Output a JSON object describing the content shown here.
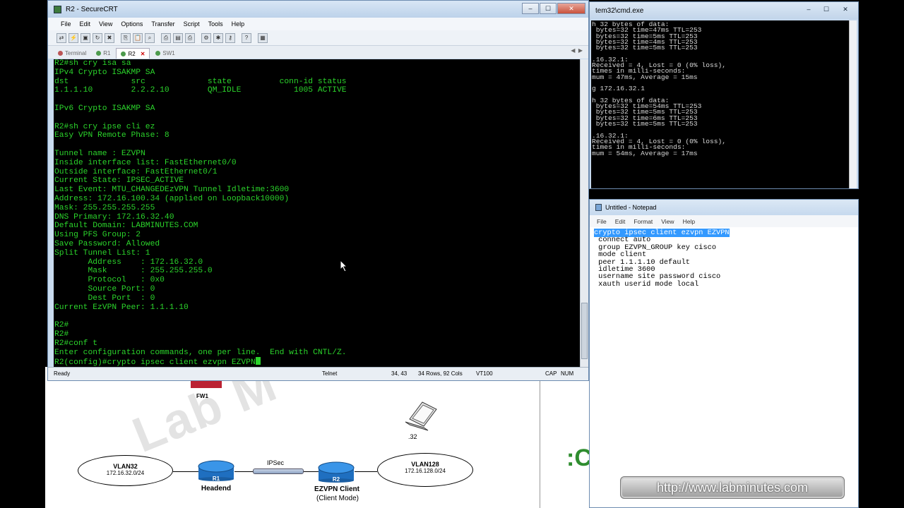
{
  "crt": {
    "title": "R2 - SecureCRT",
    "menu": [
      "File",
      "Edit",
      "View",
      "Options",
      "Transfer",
      "Script",
      "Tools",
      "Help"
    ],
    "tabs": [
      {
        "label": "Terminal",
        "active": false
      },
      {
        "label": "R1",
        "active": false
      },
      {
        "label": "R2",
        "active": true
      },
      {
        "label": "SW1",
        "active": false
      }
    ],
    "terminal_lines": [
      "R2#sh cry isa sa",
      "IPv4 Crypto ISAKMP SA",
      "dst             src             state          conn-id status",
      "1.1.1.10        2.2.2.10        QM_IDLE           1005 ACTIVE",
      "",
      "IPv6 Crypto ISAKMP SA",
      "",
      "R2#sh cry ipse cli ez",
      "Easy VPN Remote Phase: 8",
      "",
      "Tunnel name : EZVPN",
      "Inside interface list: FastEthernet0/0",
      "Outside interface: FastEthernet0/1",
      "Current State: IPSEC_ACTIVE",
      "Last Event: MTU_CHANGEDEzVPN Tunnel Idletime:3600",
      "Address: 172.16.100.34 (applied on Loopback10000)",
      "Mask: 255.255.255.255",
      "DNS Primary: 172.16.32.40",
      "Default Domain: LABMINUTES.COM",
      "Using PFS Group: 2",
      "Save Password: Allowed",
      "Split Tunnel List: 1",
      "       Address    : 172.16.32.0",
      "       Mask       : 255.255.255.0",
      "       Protocol   : 0x0",
      "       Source Port: 0",
      "       Dest Port  : 0",
      "Current EzVPN Peer: 1.1.1.10",
      "",
      "R2#",
      "R2#",
      "R2#conf t",
      "Enter configuration commands, one per line.  End with CNTL/Z.",
      "R2(config)#crypto ipsec client ezvpn EZVPN"
    ],
    "status": {
      "ready": "Ready",
      "protocol": "Telnet",
      "cursor_pos": "34, 43",
      "size": "34 Rows, 92 Cols",
      "emulation": "VT100",
      "caps": "CAP",
      "num": "NUM"
    }
  },
  "cmd": {
    "title": "tem32\\cmd.exe",
    "lines": [
      "h 32 bytes of data:",
      " bytes=32 time=47ms TTL=253",
      " bytes=32 time=5ms TTL=253",
      " bytes=32 time=4ms TTL=253",
      " bytes=32 time=5ms TTL=253",
      "",
      ".16.32.1:",
      "Received = 4, Lost = 0 (0% loss),",
      "times in milli-seconds:",
      "mum = 47ms, Average = 15ms",
      "",
      "g 172.16.32.1",
      "",
      "h 32 bytes of data:",
      " bytes=32 time=54ms TTL=253",
      " bytes=32 time=5ms TTL=253",
      " bytes=32 time=6ms TTL=253",
      " bytes=32 time=5ms TTL=253",
      "",
      ".16.32.1:",
      "Received = 4, Lost = 0 (0% loss),",
      "times in milli-seconds:",
      "mum = 54ms, Average = 17ms"
    ]
  },
  "notepad": {
    "title": "Untitled - Notepad",
    "menu": [
      "File",
      "Edit",
      "Format",
      "View",
      "Help"
    ],
    "selected_line": "crypto ipsec client ezvpn EZVPN",
    "lines": [
      " connect auto",
      " group EZVPN_GROUP key cisco",
      " mode client",
      " peer 1.1.1.10 default",
      " idletime 3600",
      " username site password cisco",
      " xauth userid mode local"
    ]
  },
  "diagram": {
    "watermark": "Lab M",
    "fw_label": "FW1",
    "vlan32": {
      "name": "VLAN32",
      "subnet": "172.16.32.0/24"
    },
    "vlan128": {
      "name": "VLAN128",
      "subnet": "172.16.128.0/24"
    },
    "r1": {
      "icon_label": "R1",
      "label": "Headend"
    },
    "r2": {
      "icon_label": "R2",
      "label": "EZVPN Client",
      "sublabel": "(Client Mode)"
    },
    "link_label": "IPSec",
    "laptop_label": ".32"
  },
  "url_badge": "http://www.labminutes.com",
  "colors": {
    "terminal_fg": "#2bd42b",
    "terminal_bg": "#000000",
    "selection": "#3399ff",
    "router": "#2a7fd4"
  }
}
